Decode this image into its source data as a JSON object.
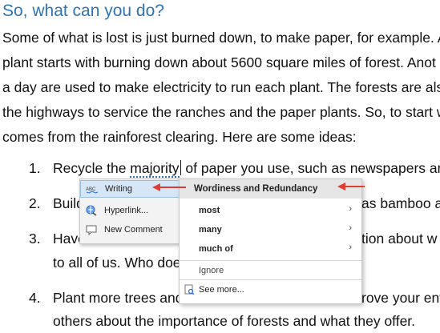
{
  "heading": "So, what can you do?",
  "paragraph_lines": [
    "Some of what is lost is just burned down, to make paper, for example. A",
    "plant starts with burning down about 5600 square miles of forest. Anot",
    "a day are used to make electricity to run each plant. The forests are als",
    "the highways to service the ranches and the paper plants. So, to start w",
    "comes from the rainforest clearing. Here are some ideas:"
  ],
  "list": {
    "item1": {
      "num": "1.",
      "pre": "Recycle the ",
      "flagged": "majority",
      "post": " of paper you use, such as newspapers and"
    },
    "item2": {
      "num": "2.",
      "start": "Build",
      "end": "as bamboo a"
    },
    "item3": {
      "num": "3.",
      "start": "Have",
      "end": "tion about w",
      "line2_start": "to all of us. Who doe"
    },
    "item4": {
      "num": "4.",
      "line1_start": "Plant more trees and",
      "line1_end": "rove your env",
      "line2": "others about the importance of forests and what they offer."
    }
  },
  "context_menu": {
    "items": [
      {
        "label": "Writing",
        "icon": "abc-icon"
      },
      {
        "label": "Hyperlink...",
        "icon": "hyperlink-icon"
      },
      {
        "label": "New Comment",
        "icon": "comment-icon"
      }
    ]
  },
  "submenu": {
    "header": "Wordiness and Redundancy",
    "suggestions": [
      "most",
      "many",
      "much of"
    ],
    "ignore": "Ignore",
    "see_more": "See more..."
  },
  "colors": {
    "heading": "#2e74b5",
    "annotation_arrow": "#e03c31",
    "selection": "#d6e6f6"
  }
}
